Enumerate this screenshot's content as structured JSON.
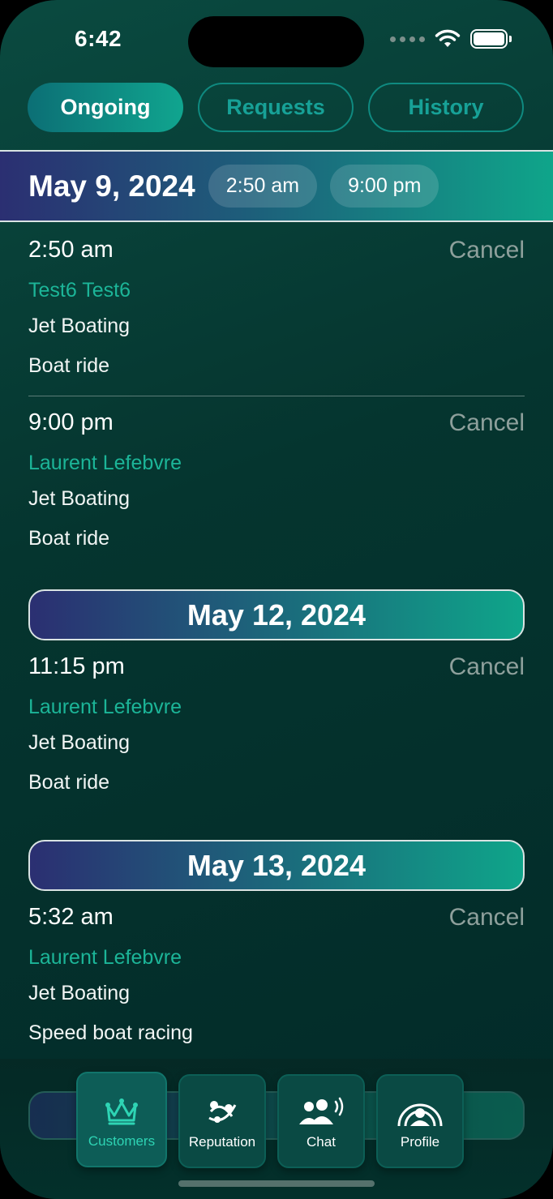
{
  "status_bar": {
    "time": "6:42"
  },
  "tabs": [
    {
      "label": "Ongoing",
      "active": true
    },
    {
      "label": "Requests",
      "active": false
    },
    {
      "label": "History",
      "active": false
    }
  ],
  "groups": [
    {
      "date": "May 9, 2024",
      "chips": [
        "2:50 am",
        "9:00 pm"
      ],
      "items": [
        {
          "time": "2:50 am",
          "customer": "Test6 Test6",
          "activity": "Jet Boating",
          "service": "Boat ride",
          "action": "Cancel"
        },
        {
          "time": "9:00 pm",
          "customer": "Laurent Lefebvre",
          "activity": "Jet Boating",
          "service": "Boat ride",
          "action": "Cancel"
        }
      ]
    },
    {
      "date": "May 12, 2024",
      "items": [
        {
          "time": "11:15 pm",
          "customer": "Laurent Lefebvre",
          "activity": "Jet Boating",
          "service": "Boat ride",
          "action": "Cancel"
        }
      ]
    },
    {
      "date": "May 13, 2024",
      "items": [
        {
          "time": "5:32 am",
          "customer": "Laurent Lefebvre",
          "activity": "Jet Boating",
          "service": "Speed boat racing",
          "action": "Cancel"
        }
      ]
    }
  ],
  "bottom_nav": [
    {
      "label": "Customers",
      "icon": "crown-icon",
      "active": true
    },
    {
      "label": "Reputation",
      "icon": "reputation-icon",
      "active": false
    },
    {
      "label": "Chat",
      "icon": "chat-people-icon",
      "active": false
    },
    {
      "label": "Profile",
      "icon": "profile-icon",
      "active": false
    }
  ],
  "colors": {
    "accent": "#1cb598",
    "cancel": "#8ea09c",
    "background": "#05352f"
  }
}
